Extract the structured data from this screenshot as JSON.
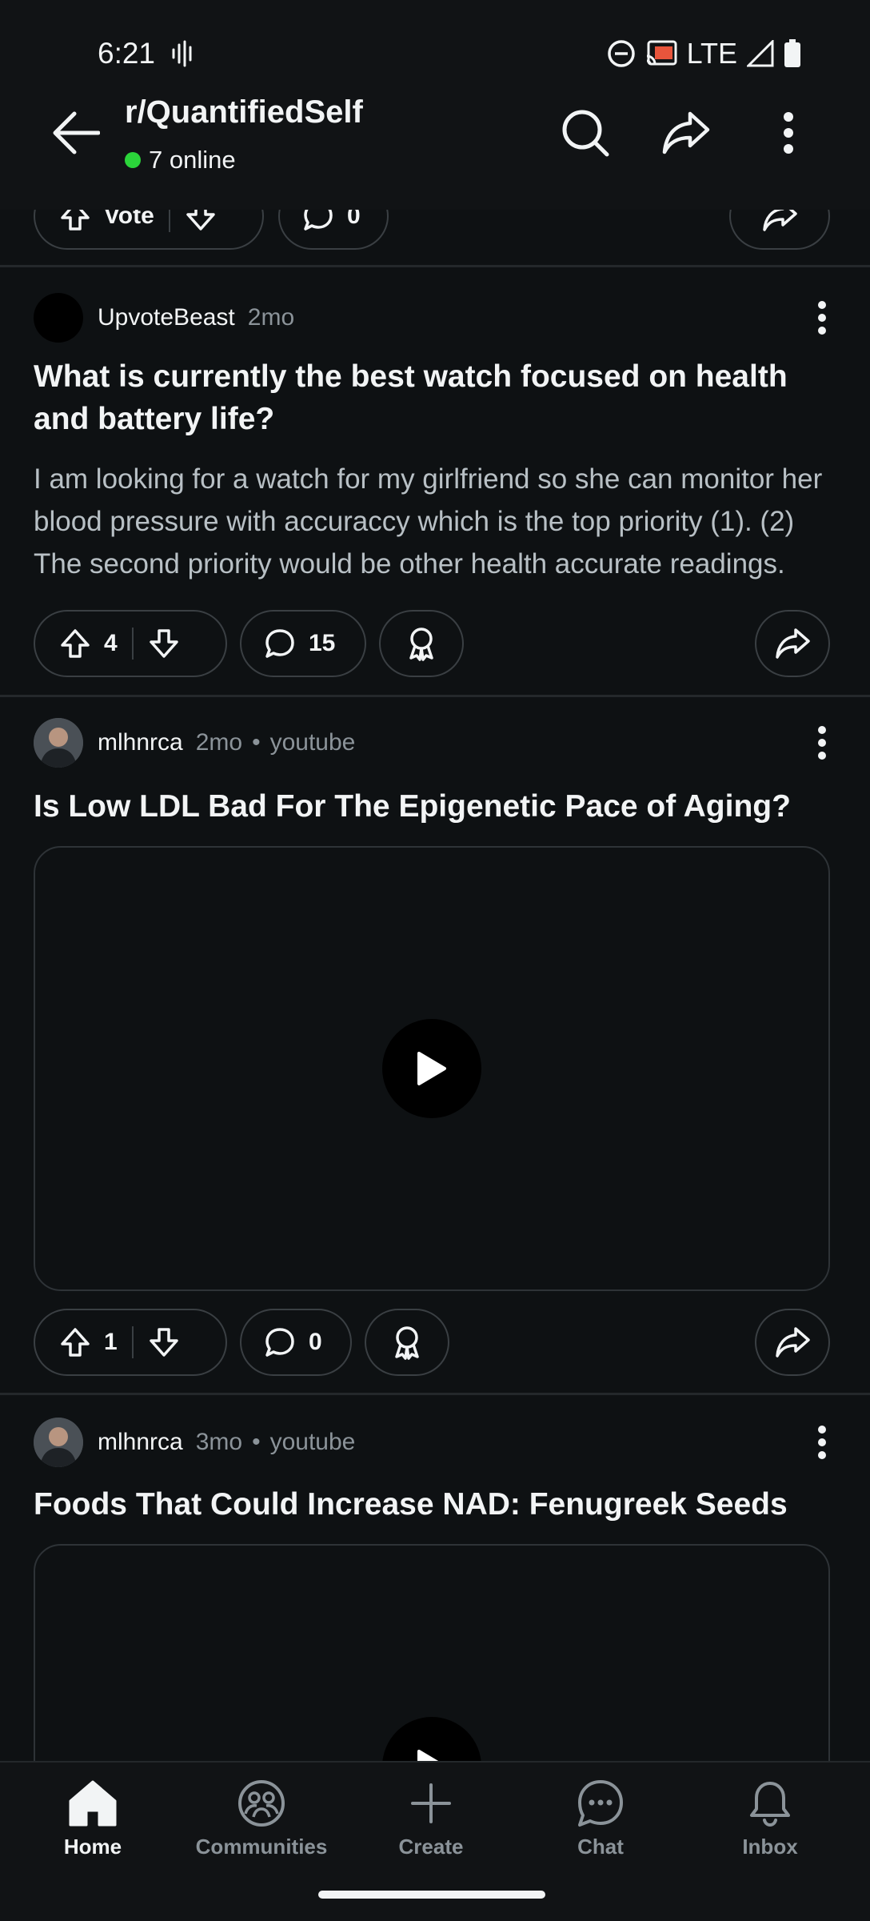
{
  "status_bar": {
    "time": "6:21",
    "network": "LTE"
  },
  "header": {
    "subreddit": "r/QuantifiedSelf",
    "online": "7 online"
  },
  "partial_post": {
    "vote_label": "Vote",
    "comments": "0"
  },
  "posts": [
    {
      "author": "UpvoteBeast",
      "age": "2mo",
      "title": "What is currently the best watch focused on health and battery life?",
      "body": "I am looking for a watch for my girlfriend so she can monitor her blood pressure with accuraccy which is the top priority (1). (2) The second priority would be other health accurate readings.",
      "votes": "4",
      "comments": "15"
    },
    {
      "author": "mlhnrca",
      "age": "2mo",
      "domain": "youtube",
      "title": "Is Low LDL Bad For The Epigenetic Pace of Aging?",
      "votes": "1",
      "comments": "0"
    },
    {
      "author": "mlhnrca",
      "age": "3mo",
      "domain": "youtube",
      "title": "Foods That Could Increase NAD: Fenugreek Seeds"
    }
  ],
  "bottom_nav": {
    "items": [
      {
        "label": "Home",
        "icon": "home-icon"
      },
      {
        "label": "Communities",
        "icon": "communities-icon"
      },
      {
        "label": "Create",
        "icon": "plus-icon"
      },
      {
        "label": "Chat",
        "icon": "chat-icon"
      },
      {
        "label": "Inbox",
        "icon": "bell-icon"
      }
    ]
  },
  "colors": {
    "background": "#0e1113",
    "online_dot": "#2bd43a",
    "muted_text": "#8b9399"
  }
}
